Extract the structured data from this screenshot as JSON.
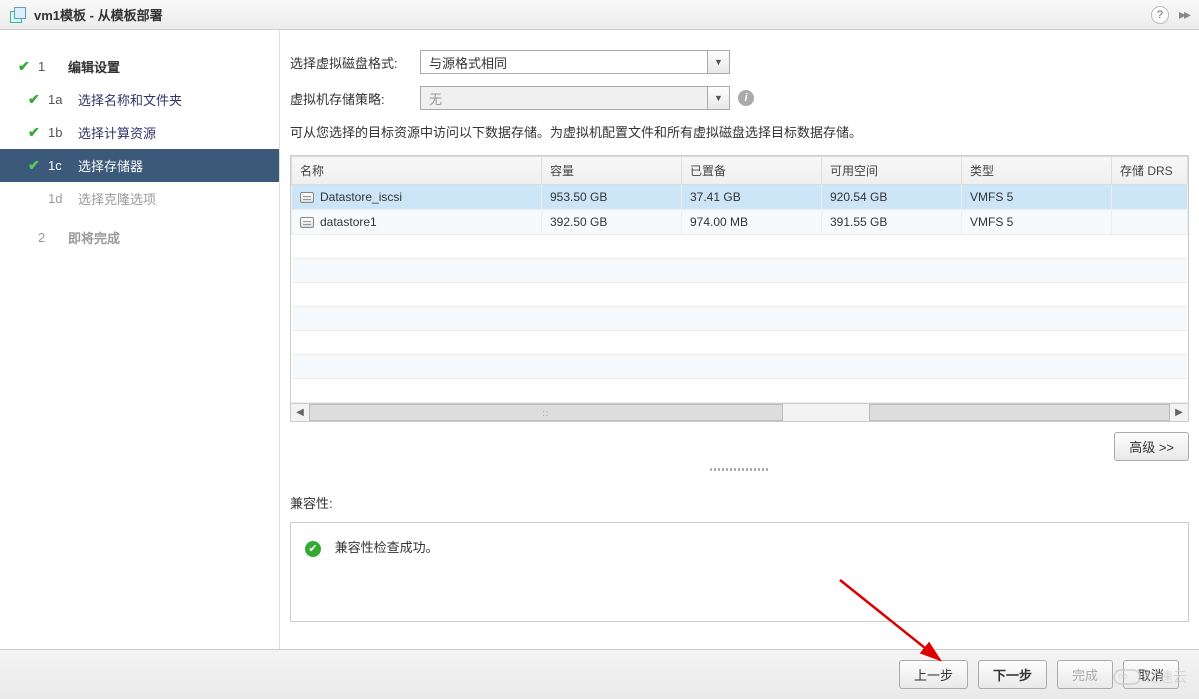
{
  "title": "vm1模板 - 从模板部署",
  "sidebar": {
    "header": {
      "num": "1",
      "label": "编辑设置"
    },
    "steps": [
      {
        "num": "1a",
        "label": "选择名称和文件夹",
        "done": true
      },
      {
        "num": "1b",
        "label": "选择计算资源",
        "done": true
      },
      {
        "num": "1c",
        "label": "选择存储器",
        "done": true,
        "active": true
      },
      {
        "num": "1d",
        "label": "选择克隆选项"
      }
    ],
    "footer": {
      "num": "2",
      "label": "即将完成"
    }
  },
  "form": {
    "disk_format_label": "选择虚拟磁盘格式:",
    "disk_format_value": "与源格式相同",
    "policy_label": "虚拟机存储策略:",
    "policy_value": "无",
    "description": "可从您选择的目标资源中访问以下数据存储。为虚拟机配置文件和所有虚拟磁盘选择目标数据存储。"
  },
  "grid": {
    "headers": {
      "name": "名称",
      "capacity": "容量",
      "provisioned": "已置备",
      "free": "可用空间",
      "type": "类型",
      "drs": "存储 DRS"
    },
    "rows": [
      {
        "name": "Datastore_iscsi",
        "capacity": "953.50 GB",
        "provisioned": "37.41 GB",
        "free": "920.54 GB",
        "type": "VMFS 5",
        "drs": "",
        "selected": true
      },
      {
        "name": "datastore1",
        "capacity": "392.50 GB",
        "provisioned": "974.00 MB",
        "free": "391.55 GB",
        "type": "VMFS 5",
        "drs": ""
      }
    ]
  },
  "advanced_label": "高级 >>",
  "compat": {
    "label": "兼容性:",
    "message": "兼容性检查成功。"
  },
  "footer": {
    "back": "上一步",
    "next": "下一步",
    "finish": "完成",
    "cancel": "取消"
  },
  "watermark": "亿速云"
}
